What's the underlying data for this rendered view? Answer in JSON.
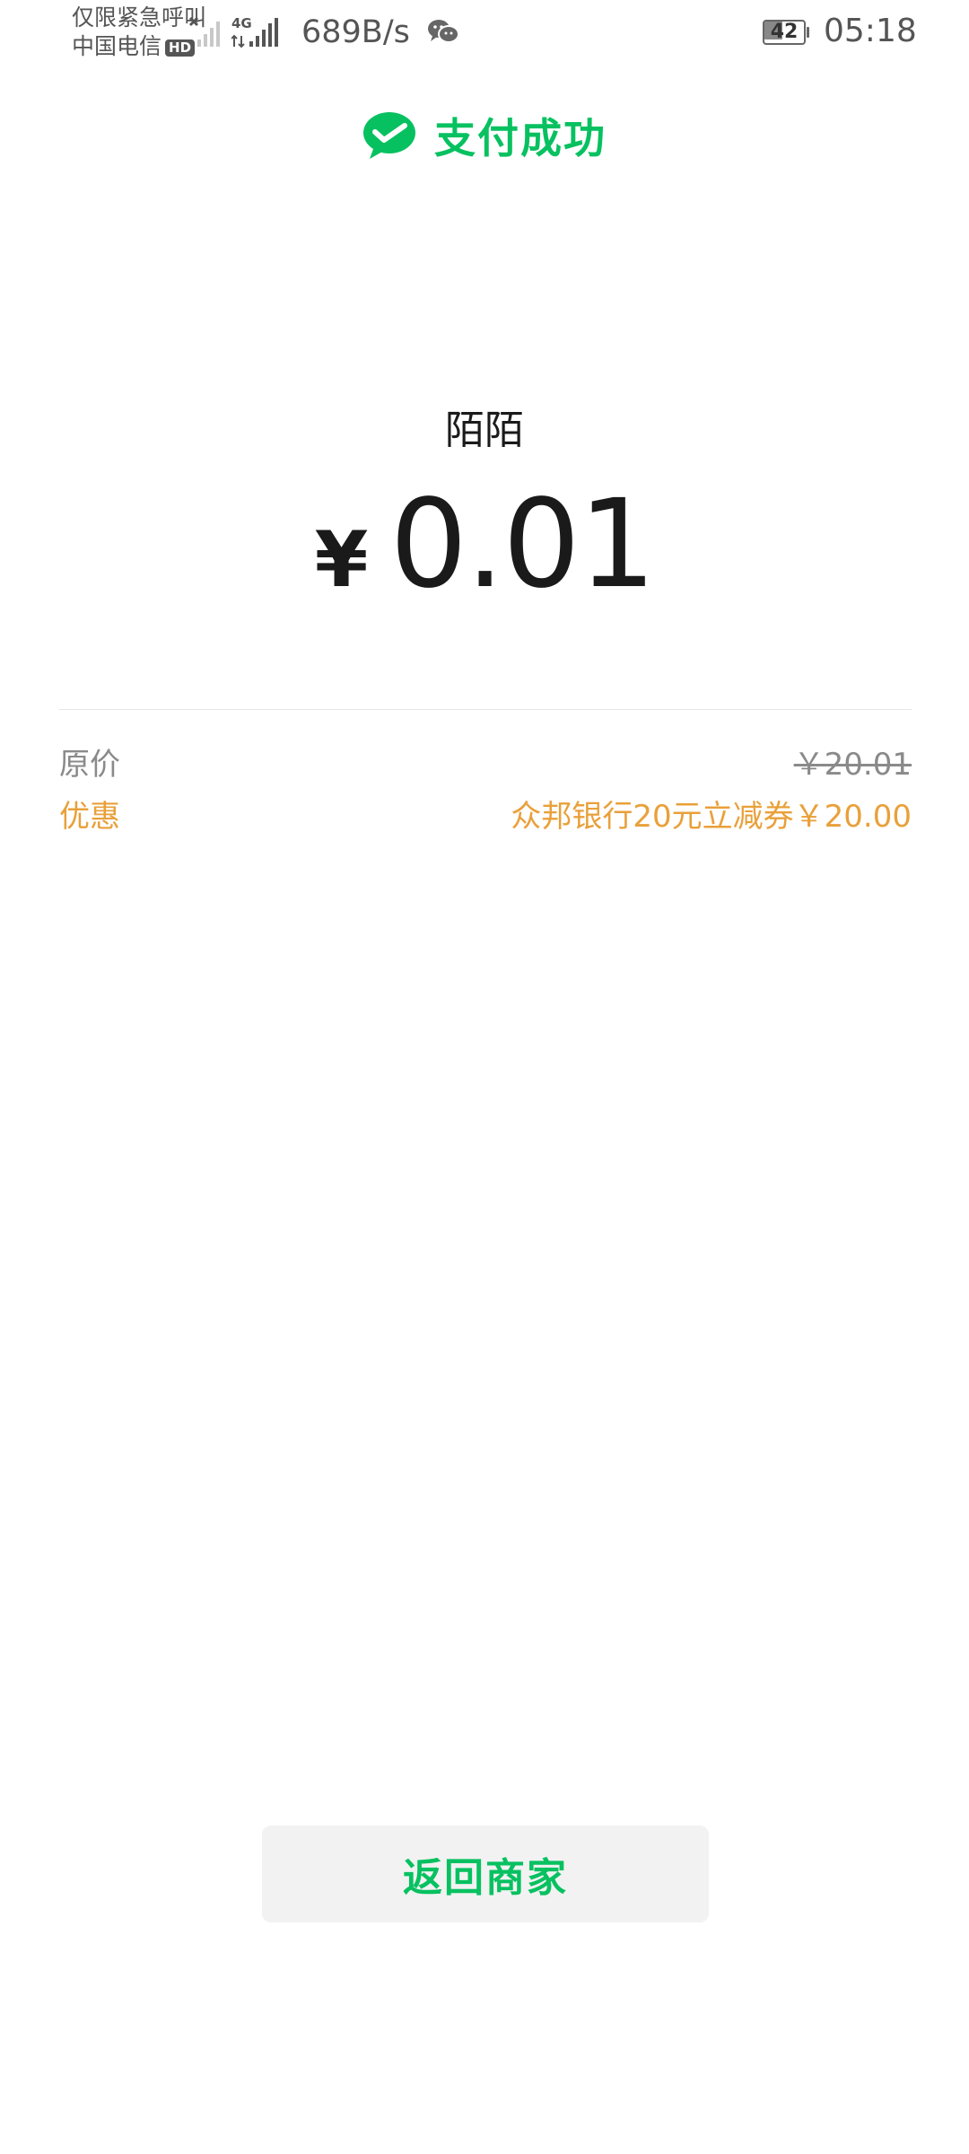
{
  "status_bar": {
    "carrier_line1": "仅限紧急呼叫",
    "carrier_line2": "中国电信",
    "hd_badge": "HD",
    "network_type": "4G",
    "net_speed": "689B/s",
    "battery_level": "42",
    "time": "05:18"
  },
  "header": {
    "title": "支付成功",
    "icon": "wechat-pay-check-icon",
    "accent_color": "#07c160"
  },
  "payment": {
    "merchant": "陌陌",
    "currency_symbol": "¥",
    "amount": "0.01"
  },
  "details": {
    "original_label": "原价",
    "original_value": "￥20.01",
    "discount_label": "优惠",
    "discount_value": "众邦银行20元立减券￥20.00",
    "discount_color": "#e9a03a"
  },
  "actions": {
    "return_label": "返回商家"
  }
}
